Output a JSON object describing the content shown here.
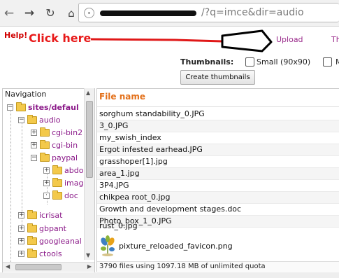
{
  "browser": {
    "url_text": "/?q=imce&dir=audio",
    "back_icon": "arrow-left",
    "forward_icon": "arrow-right",
    "reload_icon": "reload",
    "home_icon": "home"
  },
  "header": {
    "help": "Help!",
    "annotation": "Click here",
    "upload_tab": "Upload",
    "second_tab": "Th"
  },
  "thumbnails": {
    "label": "Thumbnails:",
    "small_option": "Small (90x90)",
    "second_option": "M",
    "create_button": "Create thumbnails"
  },
  "navigation": {
    "title": "Navigation",
    "root": "sites/defaul",
    "items": [
      {
        "label": "audio"
      },
      {
        "label": "cgi-bin2"
      },
      {
        "label": "cgi-bin"
      },
      {
        "label": "paypal"
      },
      {
        "label": "abdo"
      },
      {
        "label": "imag"
      },
      {
        "label": "doc"
      },
      {
        "label": "icrisat"
      },
      {
        "label": "gbpant"
      },
      {
        "label": "googleanal"
      },
      {
        "label": "ctools"
      }
    ]
  },
  "files": {
    "header": "File name",
    "rows": [
      "sorghum standability_0.JPG",
      "3_0.JPG",
      "my_swish_index",
      "Ergot infested earhead.JPG",
      "grasshoper[1].jpg",
      "area_1.jpg",
      "3P4.JPG",
      "chikpea root_0.jpg",
      "Growth and development stages.doc",
      "Photo_box_1_0.JPG",
      "rust_0.jpg"
    ],
    "thumbnail_file": "pixture_reloaded_favicon.png",
    "status": "3790 files using 1097.18 MB of unlimited quota"
  },
  "colors": {
    "link": "#8b1a89",
    "help": "#d00000",
    "annotation": "#e81a1a",
    "file_header": "#e3701a",
    "folder": "#f3c94b"
  }
}
